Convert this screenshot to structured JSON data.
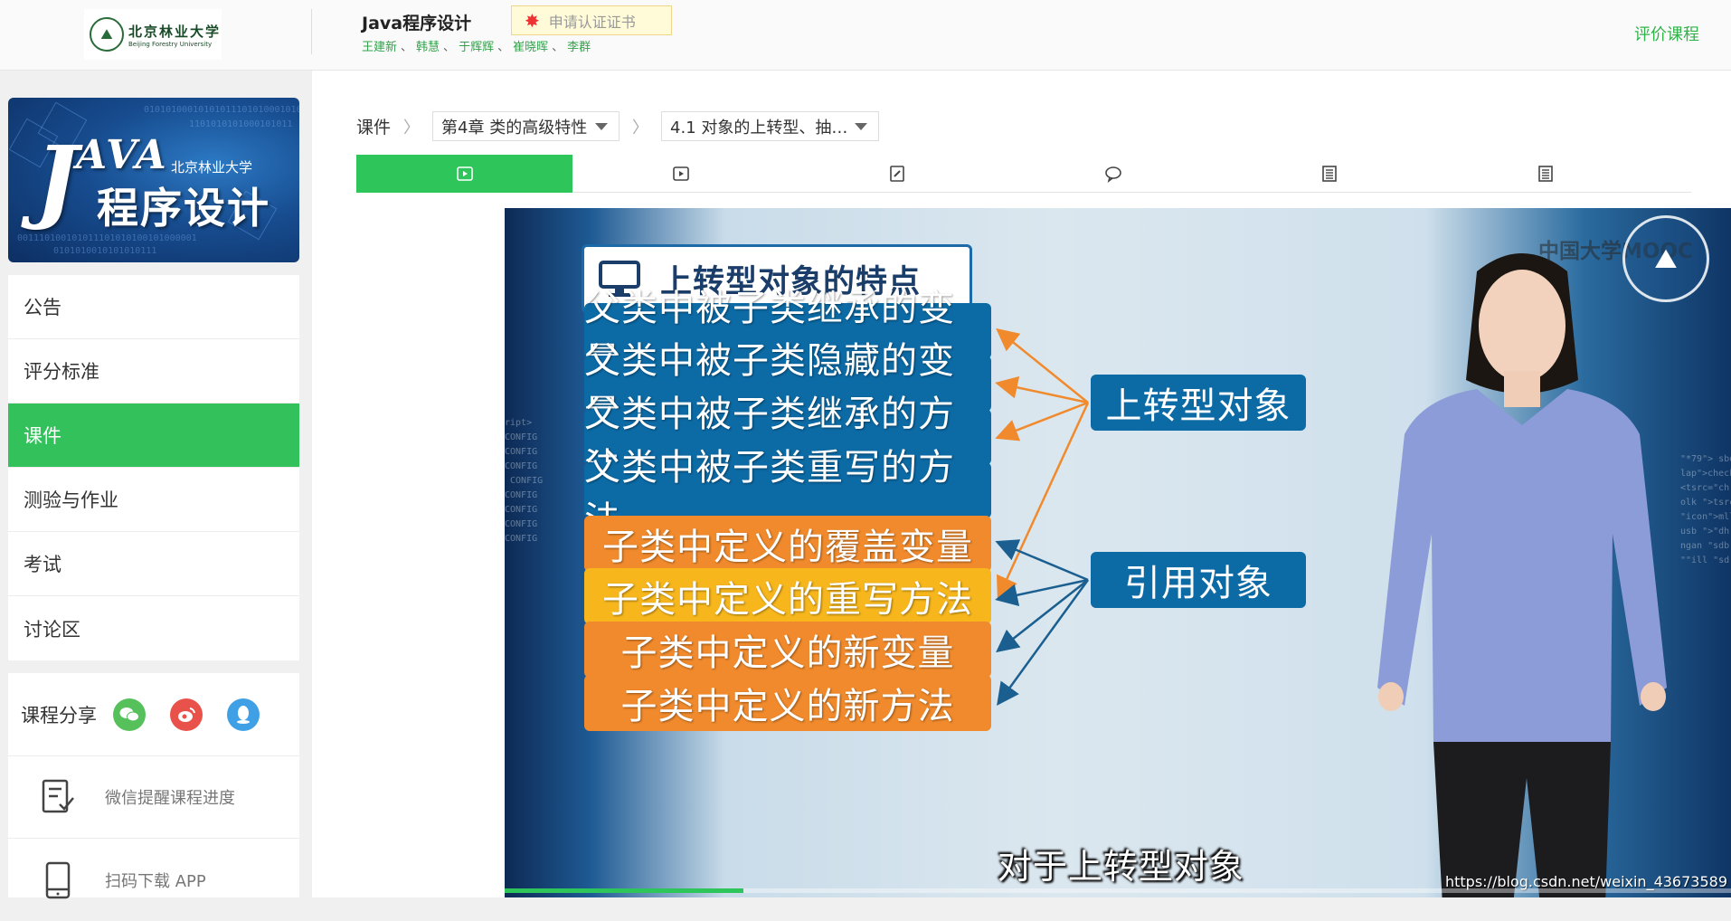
{
  "header": {
    "logo_cn": "北京林业大学",
    "logo_en": "Beijing Forestry University",
    "course_title": "Java程序设计",
    "cert_button": "申请认证证书",
    "teachers": [
      "王建新",
      "韩慧",
      "于辉辉",
      "崔晓晖",
      "李群"
    ],
    "teacher_sep": "、",
    "evaluate_link": "评价课程"
  },
  "banner": {
    "java_text": "AVA",
    "big_j": "J",
    "university": "北京林业大学",
    "program": "程序设计"
  },
  "sidebar": {
    "menu": [
      {
        "label": "公告",
        "active": false
      },
      {
        "label": "评分标准",
        "active": false
      },
      {
        "label": "课件",
        "active": true
      },
      {
        "label": "测验与作业",
        "active": false
      },
      {
        "label": "考试",
        "active": false
      },
      {
        "label": "讨论区",
        "active": false
      }
    ],
    "share_label": "课程分享",
    "wechat_reminder": "微信提醒课程进度",
    "download_app": "扫码下载 APP"
  },
  "breadcrumb": {
    "root": "课件",
    "chapter": "第4章 类的高级特性",
    "section": "4.1 对象的上转型、抽…"
  },
  "tabs": [
    {
      "icon": "video-play-icon",
      "active": true
    },
    {
      "icon": "video-play-icon",
      "active": false
    },
    {
      "icon": "edit-doc-icon",
      "active": false
    },
    {
      "icon": "discussion-icon",
      "active": false
    },
    {
      "icon": "document-icon",
      "active": false
    },
    {
      "icon": "document-icon",
      "active": false
    }
  ],
  "video": {
    "slide_title": "上转型对象的特点",
    "items": [
      {
        "text": "父类中被子类继承的变量",
        "color": "blue"
      },
      {
        "text": "父类中被子类隐藏的变量",
        "color": "blue"
      },
      {
        "text": "父类中被子类继承的方法",
        "color": "blue"
      },
      {
        "text": "父类中被子类重写的方法",
        "color": "blue"
      },
      {
        "text": "子类中定义的覆盖变量",
        "color": "orange"
      },
      {
        "text": "子类中定义的重写方法",
        "color": "yellow"
      },
      {
        "text": "子类中定义的新变量",
        "color": "orange"
      },
      {
        "text": "子类中定义的新方法",
        "color": "orange"
      }
    ],
    "target_upcast": "上转型对象",
    "target_ref": "引用对象",
    "watermark": "中国大学MOOC",
    "subtitle": "对于上转型对象",
    "source_url": "https://blog.csdn.net/weixin_43673589",
    "progress": 0.195
  },
  "colors": {
    "accent_green": "#32c15b",
    "slide_blue": "#0c6aa5",
    "slide_orange": "#f08a2c",
    "slide_yellow": "#f6b61c",
    "arrow_orange": "#f08a2c",
    "arrow_blue": "#1a5f8f"
  }
}
